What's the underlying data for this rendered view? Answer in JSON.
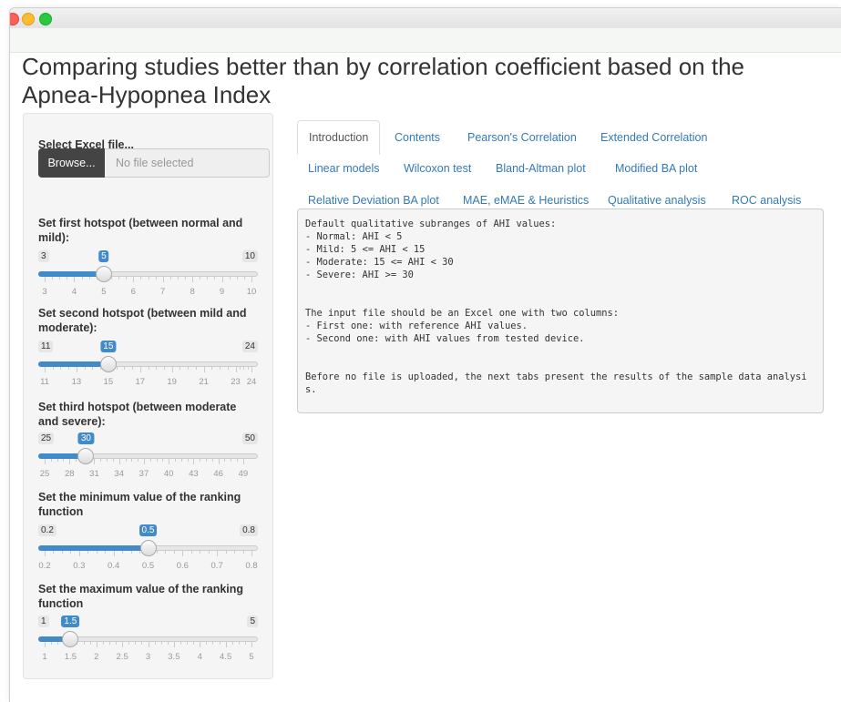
{
  "page_title": "Comparing studies better than by correlation coefficient based on the Apnea-Hypopnea Index",
  "sidebar": {
    "file_label": "Select Excel file...",
    "browse_label": "Browse...",
    "file_placeholder": "No file selected",
    "sliders": [
      {
        "label": "Set first hotspot (between normal and mild):",
        "min": 3,
        "max": 10,
        "value": 5,
        "min_text": "3",
        "max_text": "10",
        "value_text": "5",
        "ticks": [
          "3",
          "4",
          "5",
          "6",
          "7",
          "8",
          "9",
          "10"
        ]
      },
      {
        "label": "Set second hotspot (between mild and moderate):",
        "min": 11,
        "max": 24,
        "value": 15,
        "min_text": "11",
        "max_text": "24",
        "value_text": "15",
        "ticks": [
          "11",
          "13",
          "15",
          "17",
          "19",
          "21",
          "23",
          "24"
        ]
      },
      {
        "label": "Set third hotspot (between moderate and severe):",
        "min": 25,
        "max": 50,
        "value": 30,
        "min_text": "25",
        "max_text": "50",
        "value_text": "30",
        "ticks": [
          "25",
          "28",
          "31",
          "34",
          "37",
          "40",
          "43",
          "46",
          "49"
        ]
      },
      {
        "label": "Set the minimum value of the ranking function",
        "min": 0.2,
        "max": 0.8,
        "value": 0.5,
        "min_text": "0.2",
        "max_text": "0.8",
        "value_text": "0.5",
        "ticks": [
          "0.2",
          "0.3",
          "0.4",
          "0.5",
          "0.6",
          "0.7",
          "0.8"
        ]
      },
      {
        "label": "Set the maximum value of the ranking function",
        "min": 1,
        "max": 5,
        "value": 1.5,
        "min_text": "1",
        "max_text": "5",
        "value_text": "1.5",
        "ticks": [
          "1",
          "1.5",
          "2",
          "2.5",
          "3",
          "3.5",
          "4",
          "4.5",
          "5"
        ]
      }
    ]
  },
  "tabs": [
    {
      "label": "Introduction",
      "active": true
    },
    {
      "label": "Contents"
    },
    {
      "label": "Pearson's Correlation"
    },
    {
      "label": "Extended Correlation"
    },
    {
      "label": "Linear models"
    },
    {
      "label": "Wilcoxon test"
    },
    {
      "label": "Bland-Altman plot"
    },
    {
      "label": "Modified BA plot"
    },
    {
      "label": "Relative Deviation BA plot"
    },
    {
      "label": "MAE, eMAE & Heuristics"
    },
    {
      "label": "Qualitative analysis"
    },
    {
      "label": "ROC analysis"
    }
  ],
  "output_text": "Default qualitative subranges of AHI values:\n- Normal: AHI < 5\n- Mild: 5 <= AHI < 15\n- Moderate: 15 <= AHI < 30\n- Severe: AHI >= 30\n\n\nThe input file should be an Excel one with two columns:\n- First one: with reference AHI values.\n- Second one: with AHI values from tested device.\n\n\nBefore no file is uploaded, the next tabs present the results of the sample data analysis."
}
